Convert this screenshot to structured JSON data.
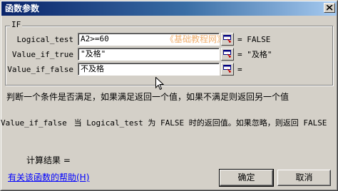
{
  "window": {
    "title": "函数参数"
  },
  "function_group": {
    "name": "IF",
    "arguments": [
      {
        "label": "Logical_test",
        "value": "A2>=60",
        "result": "= FALSE"
      },
      {
        "label": "Value_if_true",
        "value": "\"及格\"",
        "result": "= \"及格\""
      },
      {
        "label": "Value_if_false",
        "value": "不及格",
        "result": "="
      }
    ],
    "watermark": "《基础教程网》"
  },
  "description": "判断一个条件是否满足，如果满足返回一个值，如果不满足则返回另一个值",
  "param_help": {
    "name": "Value_if_false",
    "text": "当 Logical_test 为 FALSE 时的返回值。如果忽略，则返回 FALSE"
  },
  "calc_result": {
    "label": "计算结果 ="
  },
  "help_link": "有关该函数的帮助(H)",
  "buttons": {
    "ok": "确定",
    "cancel": "取消"
  },
  "icons": {
    "close": "close-icon",
    "collapse": "collapse-dialog-icon",
    "cursor": "mouse-pointer-icon"
  }
}
